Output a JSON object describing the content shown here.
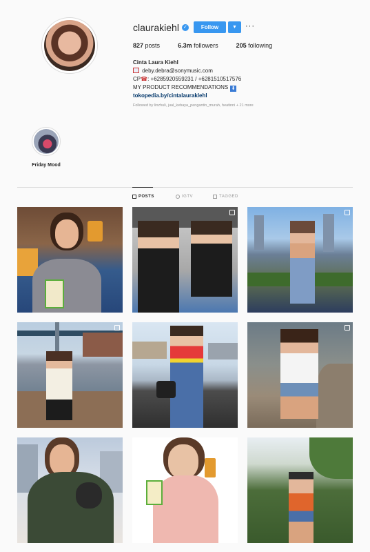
{
  "profile": {
    "username": "claurakiehl",
    "follow_label": "Follow",
    "more_label": "···",
    "stats": {
      "posts": "827",
      "posts_label": "posts",
      "followers": "6.3m",
      "followers_label": "followers",
      "following": "205",
      "following_label": "following"
    },
    "bio": {
      "name": "Cinta Laura Kiehl",
      "email": "deby.debra@sonymusic.com",
      "phone_prefix": "CP",
      "phones": ": +6285920559231 / +6281510517576",
      "recommend": "MY PRODUCT RECOMMENDATIONS",
      "link": "tokopedia.by/cintalauraklehl"
    },
    "followed_by": "Followed by linzhuli, jual_kebaya_pengantin_murah, heatinni + 21 more"
  },
  "highlights": [
    {
      "label": "Friday Mood"
    }
  ],
  "tabs": [
    {
      "label": "POSTS",
      "active": true
    },
    {
      "label": "IGTV",
      "active": false
    },
    {
      "label": "TAGGED",
      "active": false
    }
  ],
  "colors": {
    "accent": "#3897f0",
    "text": "#262626",
    "muted": "#8e8e8e",
    "link": "#003569",
    "background": "#fafafa"
  }
}
